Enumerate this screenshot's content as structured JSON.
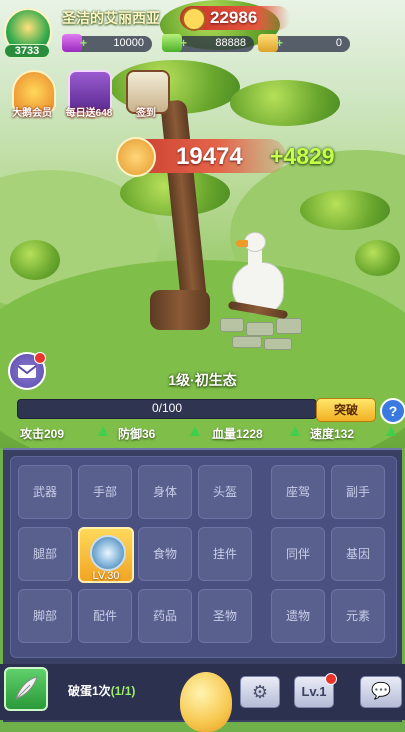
{
  "player": {
    "name": "圣洁的艾丽西亚",
    "level": "3733",
    "top_score": "22986"
  },
  "resources": [
    {
      "icon": "gem-icon",
      "value": "10000"
    },
    {
      "icon": "cash-icon",
      "value": "88888"
    },
    {
      "icon": "ticket-icon",
      "value": "0"
    }
  ],
  "top_buttons": [
    {
      "icon": "vip-crown-icon",
      "label": "大鹅会员"
    },
    {
      "icon": "gift-box-icon",
      "label": "每日送648"
    },
    {
      "icon": "calendar-icon",
      "label": "签到"
    }
  ],
  "power": {
    "value": "19474",
    "gain": "+4829"
  },
  "stage": {
    "title": "1级·初生态",
    "progress_text": "0/100",
    "progress_fraction": 0,
    "break_label": "突破",
    "help_label": "?"
  },
  "stats": [
    {
      "label": "攻击209"
    },
    {
      "label": "防御36"
    },
    {
      "label": "血量1228"
    },
    {
      "label": "速度132"
    }
  ],
  "equipment_slots": [
    {
      "label": "武器"
    },
    {
      "label": "手部"
    },
    {
      "label": "身体"
    },
    {
      "label": "头盔"
    },
    {
      "label": "座驾"
    },
    {
      "label": "副手"
    },
    {
      "label": "腿部"
    },
    {
      "label": "",
      "equipped_level": "LV.30"
    },
    {
      "label": "食物"
    },
    {
      "label": "挂件"
    },
    {
      "label": "同伴"
    },
    {
      "label": "基因"
    },
    {
      "label": "脚部"
    },
    {
      "label": "配件"
    },
    {
      "label": "药品"
    },
    {
      "label": "圣物"
    },
    {
      "label": "遗物"
    },
    {
      "label": "元素"
    }
  ],
  "bottom": {
    "hatch_label": "破蛋1次",
    "hatch_count": "(1/1)",
    "gear_icon": "⚙",
    "level_button": "Lv.1",
    "chat_icon": "💬"
  },
  "colors": {
    "accent_red": "#e4583f",
    "accent_green": "#c7ff4a",
    "panel_bg": "#3a4063"
  }
}
